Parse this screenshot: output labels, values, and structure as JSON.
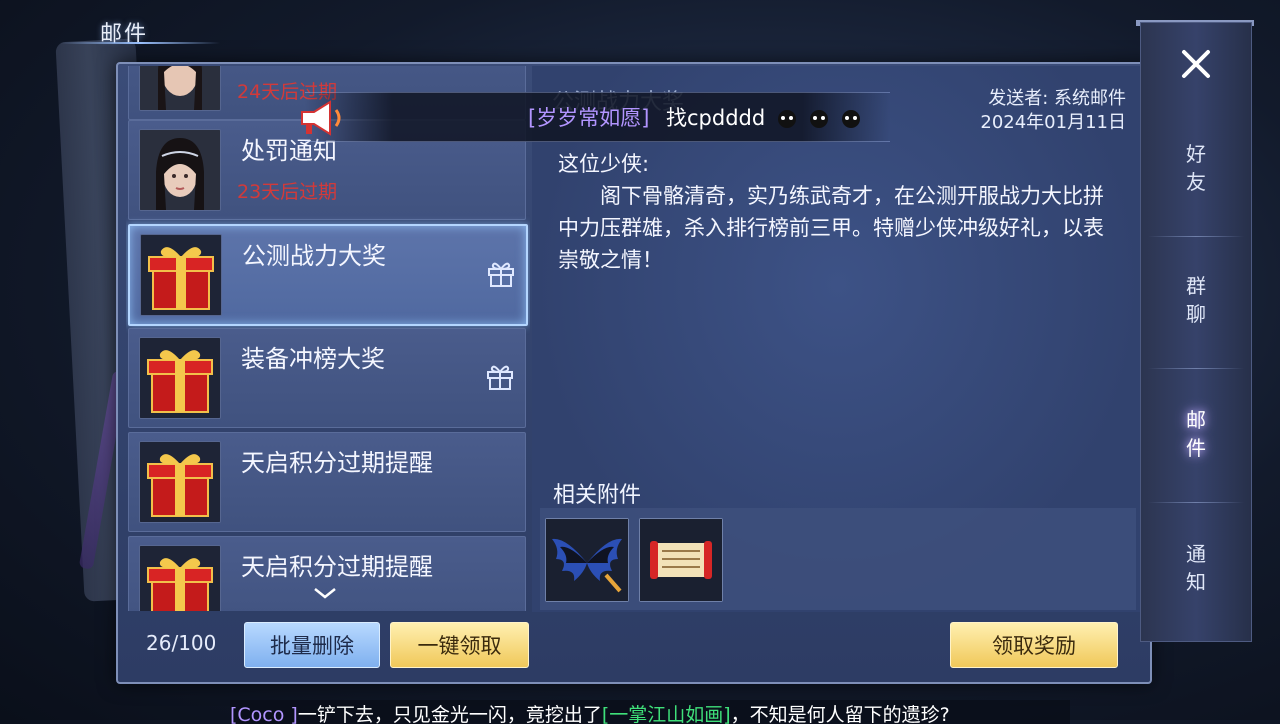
{
  "page_title": "邮件",
  "mail_list": [
    {
      "title": "",
      "expire": "24天后过期",
      "thumb": "avatar"
    },
    {
      "title": "处罚通知",
      "expire": "23天后过期",
      "thumb": "avatar"
    },
    {
      "title": "公测战力大奖",
      "expire": "",
      "thumb": "gift-box",
      "has_gift": true,
      "selected": true
    },
    {
      "title": "装备冲榜大奖",
      "expire": "",
      "thumb": "gift-box",
      "has_gift": true
    },
    {
      "title": "天启积分过期提醒",
      "expire": "",
      "thumb": "gift-box"
    },
    {
      "title": "天启积分过期提醒",
      "expire": "",
      "thumb": "gift-box"
    }
  ],
  "mail_count": "26/100",
  "buttons": {
    "batch_delete": "批量删除",
    "claim_all": "一键领取",
    "claim_reward": "领取奖励"
  },
  "detail": {
    "subject": "公测战力大奖",
    "sender": "发送者: 系统邮件",
    "date": "2024年01月11日",
    "greeting": "这位少侠:",
    "body": "阁下骨骼清奇，实乃练武奇才，在公测开服战力大比拼中力压群雄，杀入排行榜前三甲。特赠少侠冲级好礼，以表崇敬之情！",
    "attachments_label": "相关附件",
    "attachments": [
      {
        "icon": "wings-icon"
      },
      {
        "icon": "scroll-icon"
      }
    ]
  },
  "marquee": {
    "channel": "[岁岁常如愿]",
    "text": "找cpdddd"
  },
  "sidebar": {
    "items": [
      {
        "label": "好\n友"
      },
      {
        "label": "群\n聊"
      },
      {
        "label": "邮\n件",
        "active": true
      },
      {
        "label": "通\n知"
      }
    ]
  },
  "bottom_chat": {
    "name": "[Coco ]",
    "text1": "一铲下去，只见金光一闪，竟挖出了",
    "item": "[一掌江山如画]",
    "text2": "，不知是何人留下的遗珍?"
  },
  "colors": {
    "expire_red": "#d23a3a",
    "channel_purple": "#b295ff",
    "item_green": "#3fe07a",
    "gold_button": "#f0c85a",
    "blue_button": "#7fb0ef"
  }
}
